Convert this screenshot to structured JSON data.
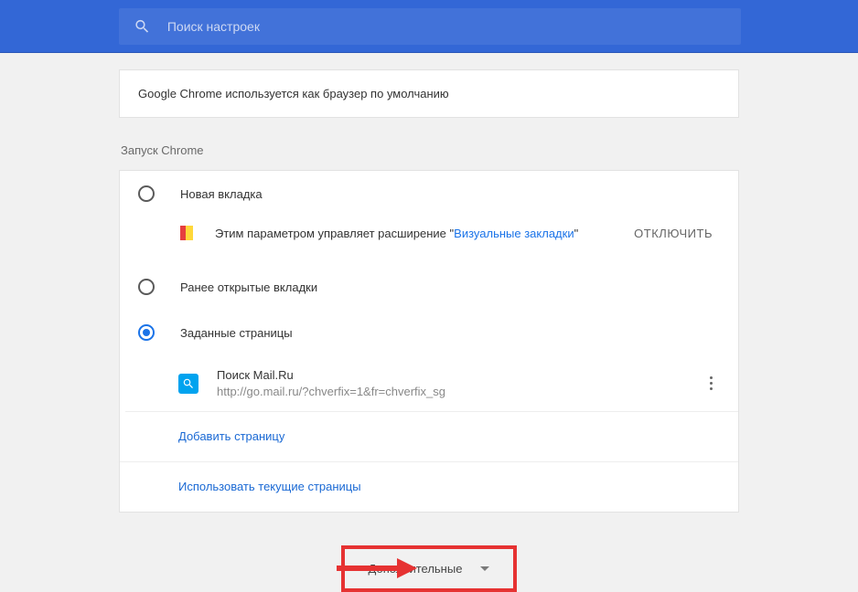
{
  "search": {
    "placeholder": "Поиск настроек"
  },
  "default_browser": {
    "text": "Google Chrome используется как браузер по умолчанию"
  },
  "startup": {
    "title": "Запуск Chrome",
    "options": [
      {
        "label": "Новая вкладка",
        "selected": false
      },
      {
        "label": "Ранее открытые вкладки",
        "selected": false
      },
      {
        "label": "Заданные страницы",
        "selected": true
      }
    ],
    "extension_notice": {
      "prefix": "Этим параметром управляет расширение \"",
      "link": "Визуальные закладки",
      "suffix": "\"",
      "disable": "ОТКЛЮЧИТЬ"
    },
    "pages": [
      {
        "title": "Поиск Mail.Ru",
        "url": "http://go.mail.ru/?chverfix=1&fr=chverfix_sg"
      }
    ],
    "add_page": "Добавить страницу",
    "use_current": "Использовать текущие страницы"
  },
  "advanced": {
    "label": "Дополнительные"
  }
}
